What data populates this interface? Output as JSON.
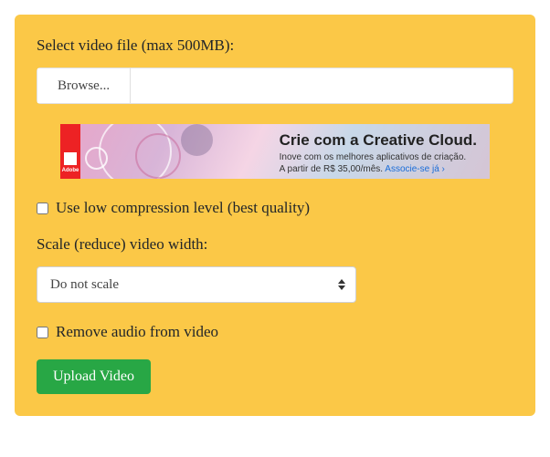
{
  "labels": {
    "select_file": "Select video file (max 500MB):",
    "browse": "Browse...",
    "low_compression": "Use low compression level (best quality)",
    "scale_label": "Scale (reduce) video width:",
    "scale_selected": "Do not scale",
    "remove_audio": "Remove audio from video",
    "upload": "Upload Video"
  },
  "file": {
    "name": ""
  },
  "ad": {
    "logo_text": "Adobe",
    "headline": "Crie com a Creative Cloud.",
    "subline1": "Inove com os melhores aplicativos de criação.",
    "subline2_prefix": "A partir de R$ 35,00/mês. ",
    "link_text": "Associe-se já ›"
  }
}
